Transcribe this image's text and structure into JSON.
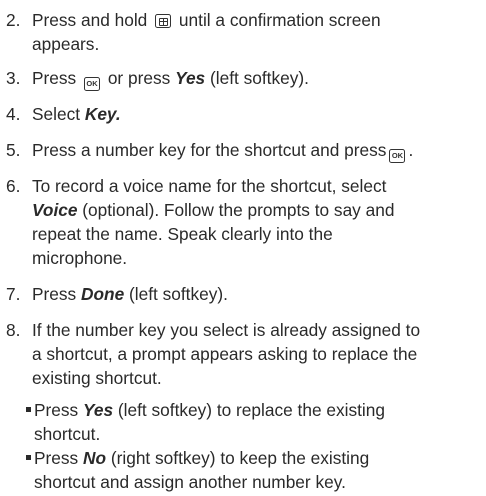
{
  "steps": [
    {
      "num": "2.",
      "before": "Press and hold",
      "key": "menu-key",
      "after": "until a confirmation screen",
      "line2": "appears."
    },
    {
      "num": "3.",
      "before": "Press",
      "key": "ok-key",
      "key_label": "OK",
      "mid": "or press",
      "bold": "Yes",
      "after": "(left softkey)."
    },
    {
      "num": "4.",
      "before": "Select",
      "bold": "Key."
    },
    {
      "num": "5.",
      "before": "Press a number key for the shortcut and press",
      "key": "ok-key",
      "key_label": "OK",
      "after": "."
    },
    {
      "num": "6.",
      "line1": "To record a voice name for the shortcut, select",
      "bold": "Voice",
      "line2_after": "(optional). Follow the prompts to say and",
      "line3": "repeat the name. Speak clearly into the",
      "line4": "microphone."
    },
    {
      "num": "7.",
      "before": "Press",
      "bold": "Done",
      "after": "(left softkey)."
    },
    {
      "num": "8.",
      "line1": "If the number key you select is already assigned to",
      "line2": "a shortcut, a prompt appears asking to replace the",
      "line3": "existing shortcut."
    }
  ],
  "bullets": [
    {
      "before": "Press",
      "bold": "Yes",
      "after": "(left softkey) to replace the existing",
      "line2": "shortcut."
    },
    {
      "before": "Press",
      "bold": "No",
      "after": "(right softkey) to keep the existing",
      "line2": "shortcut and assign another number key."
    }
  ]
}
